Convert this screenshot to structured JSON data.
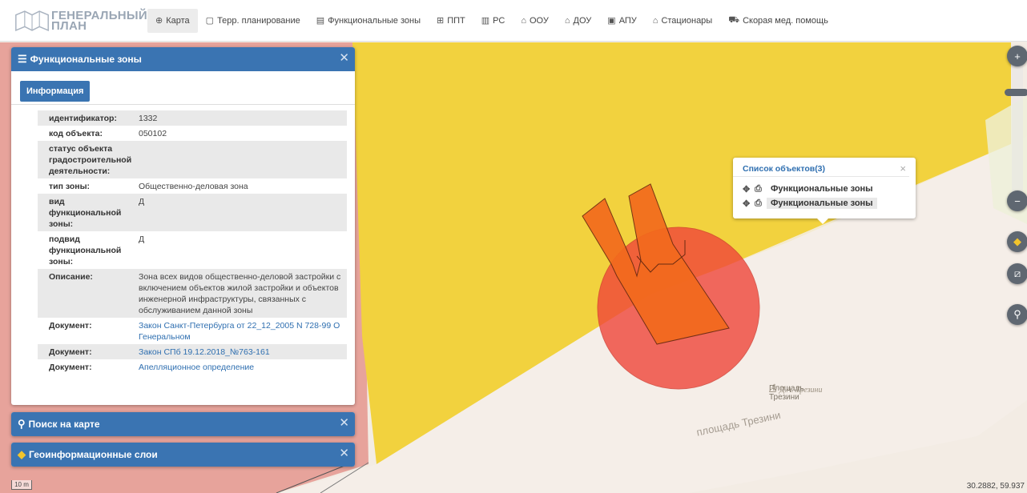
{
  "header": {
    "logo_line1": "ГЕНЕРАЛЬНЫЙ",
    "logo_line2": "ПЛАН",
    "nav": [
      {
        "label": "Карта",
        "icon": "globe-icon",
        "glyph": "⊕"
      },
      {
        "label": "Терр. планирование",
        "icon": "document-icon",
        "glyph": "▢"
      },
      {
        "label": "Функциональные зоны",
        "icon": "list-icon",
        "glyph": "▤"
      },
      {
        "label": "ППТ",
        "icon": "grid-icon",
        "glyph": "⊞"
      },
      {
        "label": "РС",
        "icon": "doc-icon",
        "glyph": "▥"
      },
      {
        "label": "ООУ",
        "icon": "school-icon",
        "glyph": "⌂"
      },
      {
        "label": "ДОУ",
        "icon": "kindergarten-icon",
        "glyph": "⌂"
      },
      {
        "label": "АПУ",
        "icon": "clinic-icon",
        "glyph": "▣"
      },
      {
        "label": "Стационары",
        "icon": "hospital-icon",
        "glyph": "⌂"
      },
      {
        "label": "Скорая мед. помощь",
        "icon": "ambulance-icon",
        "glyph": "⛟"
      }
    ]
  },
  "zones_panel": {
    "title": "Функциональные зоны",
    "tab_label": "Информация",
    "rows": [
      {
        "key": "идентификатор:",
        "value": "1332",
        "link": false
      },
      {
        "key": "код объекта:",
        "value": "050102",
        "link": false
      },
      {
        "key": "статус объекта градостроительной деятельности:",
        "value": "",
        "link": false
      },
      {
        "key": "тип зоны:",
        "value": "Общественно-деловая зона",
        "link": false
      },
      {
        "key": "вид функциональной зоны:",
        "value": "Д",
        "link": false
      },
      {
        "key": "подвид функциональной зоны:",
        "value": "Д",
        "link": false
      },
      {
        "key": "Описание:",
        "value": "Зона всех видов общественно-деловой застройки с включением объектов жилой застройки и объектов инженерной инфраструктуры, связанных с обслуживанием данной зоны",
        "link": false
      },
      {
        "key": "Документ:",
        "value": "Закон Санкт-Петербурга от 22_12_2005 N 728-99 О Генеральном",
        "link": true
      },
      {
        "key": "Документ:",
        "value": "Закон СПб 19.12.2018_№763-161",
        "link": true
      },
      {
        "key": "Документ:",
        "value": "Апелляционное определение",
        "link": true
      }
    ]
  },
  "search_panel": {
    "title": "Поиск на карте"
  },
  "layers_panel": {
    "title": "Геоинформационные слои"
  },
  "popup": {
    "title": "Список объектов(3)",
    "items": [
      {
        "label": "Функциональные зоны",
        "selected": false
      },
      {
        "label": "Функциональные зоны",
        "selected": true
      }
    ]
  },
  "map": {
    "labels": {
      "square_name": "Площадь Трезини",
      "street": "площадь Трезини",
      "monument": "Д.А. Трезини"
    },
    "scale_label": "10 m",
    "coords": "30.2882, 59.937",
    "colors": {
      "zone_yellow": "#f2d23e",
      "buffer_red": "#f0463a",
      "building_orange": "#f36a1d",
      "panel_blue": "#3a74b2"
    }
  }
}
